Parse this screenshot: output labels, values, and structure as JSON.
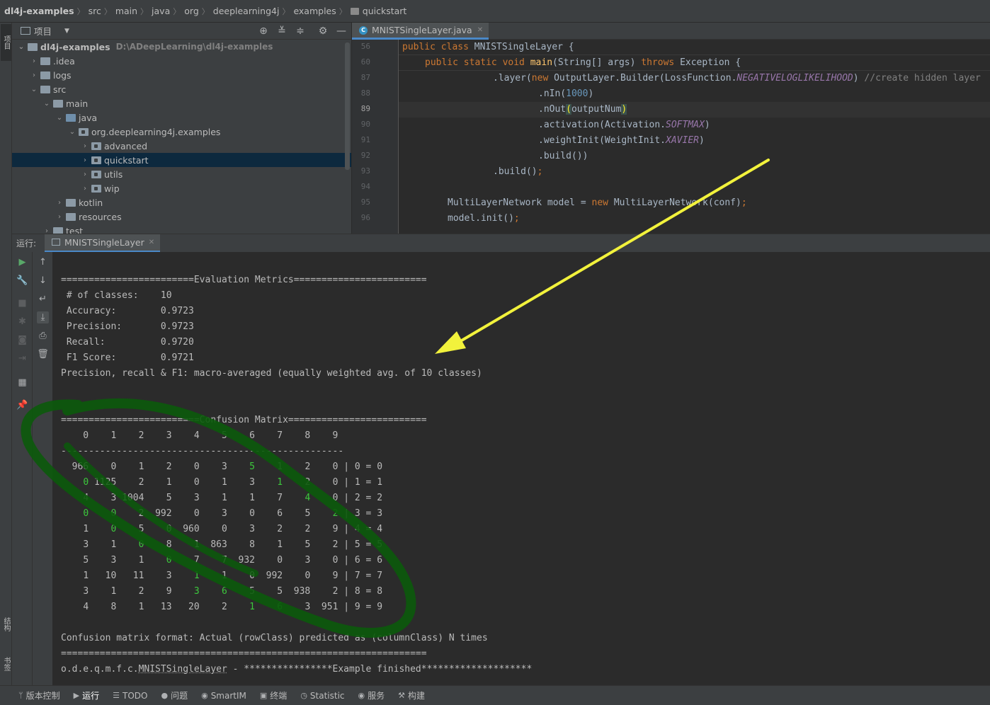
{
  "breadcrumb": [
    "dl4j-examples",
    "src",
    "main",
    "java",
    "org",
    "deeplearning4j",
    "examples",
    "quickstart"
  ],
  "left_strip": {
    "project_tab": "项目",
    "structure_tab": "结构",
    "bookmarks_tab": "书签"
  },
  "project_panel": {
    "title": "项目",
    "tree": [
      {
        "label": "dl4j-examples",
        "path": "D:\\ADeepLearning\\dl4j-examples"
      },
      {
        "label": ".idea"
      },
      {
        "label": "logs"
      },
      {
        "label": "src"
      },
      {
        "label": "main"
      },
      {
        "label": "java"
      },
      {
        "label": "org.deeplearning4j.examples"
      },
      {
        "label": "advanced"
      },
      {
        "label": "quickstart"
      },
      {
        "label": "utils"
      },
      {
        "label": "wip"
      },
      {
        "label": "kotlin"
      },
      {
        "label": "resources"
      },
      {
        "label": "test"
      }
    ]
  },
  "editor": {
    "tab_label": "MNISTSingleLayer.java",
    "line_numbers": [
      "56",
      "60",
      "87",
      "88",
      "89",
      "90",
      "91",
      "92",
      "93",
      "94",
      "95",
      "96"
    ],
    "current_line": "89",
    "lines": {
      "l56": [
        "public class ",
        "MNISTSingleLayer {"
      ],
      "l60": [
        "public static void ",
        "main",
        "(String[] args) ",
        "throws ",
        "Exception {"
      ],
      "l87": [
        ".layer(",
        "new ",
        "OutputLayer.Builder(LossFunction.",
        "NEGATIVELOGLIKELIHOOD",
        ") ",
        "//create hidden layer"
      ],
      "l88": [
        ".nIn(",
        "1000",
        ")"
      ],
      "l89": [
        ".nOut",
        "(",
        "outputNum",
        ")"
      ],
      "l90": [
        ".activation(Activation.",
        "SOFTMAX",
        ")"
      ],
      "l91": [
        ".weightInit(WeightInit.",
        "XAVIER",
        ")"
      ],
      "l92": [
        ".build())"
      ],
      "l93": [
        ".build()",
        ";"
      ],
      "l95": [
        "MultiLayerNetwork model = ",
        "new ",
        "MultiLayerNetwork(conf)",
        ";"
      ],
      "l96": [
        "model.init()",
        ";"
      ]
    }
  },
  "run_window": {
    "label": "运行:",
    "tab_label": "MNISTSingleLayer"
  },
  "console": {
    "eval_header": "========================Evaluation Metrics========================",
    "metrics": [
      " # of classes:    10",
      " Accuracy:        0.9723",
      " Precision:       0.9723",
      " Recall:          0.9720",
      " F1 Score:        0.9721"
    ],
    "macro_note": "Precision, recall & F1: macro-averaged (equally weighted avg. of 10 classes)",
    "cm_header": "=========================Confusion Matrix=========================",
    "cm_columns": "    0    1    2    3    4    5    6    7    8    9",
    "cm_separator": "---------------------------------------------------",
    "cm_rows": [
      {
        "cells": [
          "966",
          "0",
          "1",
          "2",
          "0",
          "3",
          "5",
          "1",
          "2",
          "0"
        ],
        "label": "0 = 0",
        "green": [
          6
        ]
      },
      {
        "cells": [
          "0",
          "1125",
          "2",
          "1",
          "0",
          "1",
          "3",
          "1",
          "2",
          "0"
        ],
        "label": "1 = 1",
        "green": [
          0,
          7
        ]
      },
      {
        "cells": [
          "4",
          "3",
          "1004",
          "5",
          "3",
          "1",
          "1",
          "7",
          "4",
          "0"
        ],
        "label": "2 = 2",
        "green": [
          8
        ]
      },
      {
        "cells": [
          "0",
          "0",
          "2",
          "992",
          "0",
          "3",
          "0",
          "6",
          "5",
          "2"
        ],
        "label": "3 = 3",
        "green": [
          0,
          1,
          9
        ]
      },
      {
        "cells": [
          "1",
          "0",
          "5",
          "0",
          "960",
          "0",
          "3",
          "2",
          "2",
          "9"
        ],
        "label": "4 = 4",
        "green": [
          1
        ]
      },
      {
        "cells": [
          "3",
          "1",
          "0",
          "8",
          "1",
          "863",
          "8",
          "1",
          "5",
          "2"
        ],
        "label": "5 = 5",
        "green": [
          2
        ]
      },
      {
        "cells": [
          "5",
          "3",
          "1",
          "0",
          "7",
          "7",
          "932",
          "0",
          "3",
          "0"
        ],
        "label": "6 = 6",
        "green": [
          3
        ]
      },
      {
        "cells": [
          "1",
          "10",
          "11",
          "3",
          "1",
          "1",
          "0",
          "992",
          "0",
          "9"
        ],
        "label": "7 = 7",
        "green": [
          4
        ]
      },
      {
        "cells": [
          "3",
          "1",
          "2",
          "9",
          "3",
          "6",
          "5",
          "5",
          "938",
          "2"
        ],
        "label": "8 = 8",
        "green": [
          4,
          5
        ]
      },
      {
        "cells": [
          "4",
          "8",
          "1",
          "13",
          "20",
          "2",
          "1",
          "6",
          "3",
          "951"
        ],
        "label": "9 = 9",
        "green": [
          6,
          7
        ]
      }
    ],
    "cm_footer": "Confusion matrix format: Actual (rowClass) predicted as (columnClass) N times",
    "end_rule": "==================================================================",
    "finish_prefix": "o.d.e.q.m.f.c.",
    "finish_class": "MNISTSingleLayer",
    "finish_suffix": " - ****************Example finished********************"
  },
  "status_bar": {
    "items": [
      "版本控制",
      "运行",
      "TODO",
      "问题",
      "SmartIM",
      "终端",
      "Statistic",
      "服务",
      "构建"
    ]
  },
  "colors": {
    "editor_bg": "#2b2b2b",
    "panel_bg": "#3c3f41",
    "keyword": "#cc7832",
    "method": "#ffc66d",
    "number": "#6897bb",
    "constant": "#9876aa",
    "annotation_arrow": "#f2f23c",
    "annotation_circle": "#0b5a0b",
    "highlight_digits": "#3cc83c"
  },
  "icons": {
    "project_header": [
      "crosshair-icon",
      "expand-all-icon",
      "collapse-all-icon",
      "gear-icon",
      "minimize-icon"
    ],
    "run_tools_left": [
      "run-icon",
      "wrench-icon",
      "stop-icon",
      "debug-icon",
      "camera-icon",
      "exit-icon",
      "layout-icon",
      "pin-icon"
    ],
    "run_tools_right": [
      "up-arrow-icon",
      "down-arrow-icon",
      "soft-wrap-icon",
      "scroll-to-end-icon",
      "print-icon",
      "trash-icon"
    ]
  }
}
